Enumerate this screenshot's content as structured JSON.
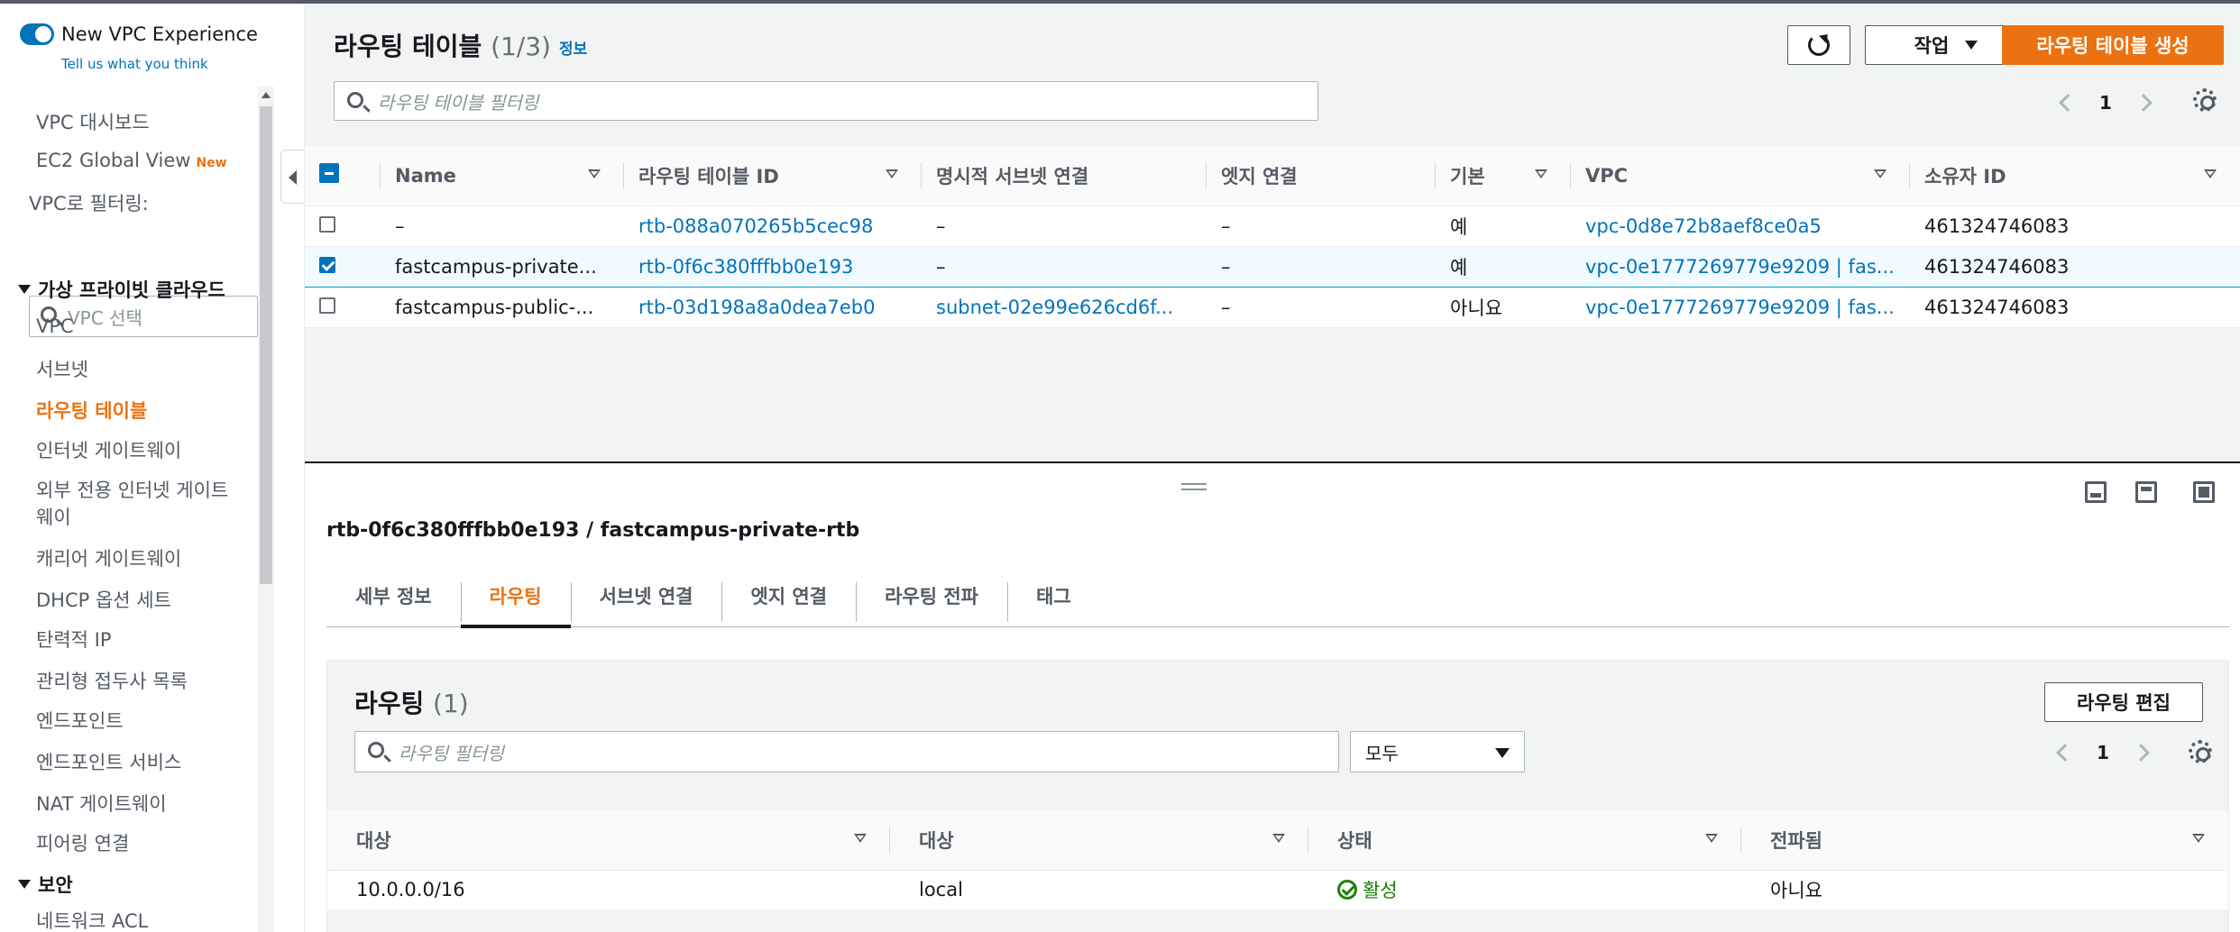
{
  "sidebar": {
    "new_vpc_experience": "New VPC Experience",
    "tell_us": "Tell us what you think",
    "dashboard": "VPC 대시보드",
    "ec2_global_view": "EC2 Global View",
    "new_badge": "New",
    "filter_label": "VPC로 필터링:",
    "vpc_select_placeholder": "VPC 선택",
    "group_vpc": "가상 프라이빗 클라우드",
    "items": [
      "VPC",
      "서브넷",
      "라우팅 테이블",
      "인터넷 게이트웨이",
      "외부 전용 인터넷 게이트",
      "웨이",
      "캐리어 게이트웨이",
      "DHCP 옵션 세트",
      "탄력적 IP",
      "관리형 접두사 목록",
      "엔드포인트",
      "엔드포인트 서비스",
      "NAT 게이트웨이",
      "피어링 연결"
    ],
    "group_security": "보안",
    "security_items": [
      "네트워크 ACL"
    ]
  },
  "header": {
    "title": "라우팅 테이블",
    "count": "(1/3)",
    "info": "정보",
    "actions_label": "작업",
    "create_label": "라우팅 테이블 생성",
    "filter_placeholder": "라우팅 테이블 필터링",
    "page": "1"
  },
  "table": {
    "columns": [
      "Name",
      "라우팅 테이블 ID",
      "명시적 서브넷 연결",
      "엣지 연결",
      "기본",
      "VPC",
      "소유자 ID"
    ],
    "rows": [
      {
        "name": "–",
        "id": "rtb-088a070265b5cec98",
        "subnet": "–",
        "edge": "–",
        "main": "예",
        "vpc": "vpc-0d8e72b8aef8ce0a5",
        "owner": "461324746083",
        "selected": false
      },
      {
        "name": "fastcampus-private...",
        "id": "rtb-0f6c380fffbb0e193",
        "subnet": "–",
        "edge": "–",
        "main": "예",
        "vpc": "vpc-0e1777269779e9209 | fas...",
        "owner": "461324746083",
        "selected": true
      },
      {
        "name": "fastcampus-public-...",
        "id": "rtb-03d198a8a0dea7eb0",
        "subnet": "subnet-02e99e626cd6f...",
        "edge": "–",
        "main": "아니요",
        "vpc": "vpc-0e1777269779e9209 | fas...",
        "owner": "461324746083",
        "selected": false
      }
    ]
  },
  "detail": {
    "title": "rtb-0f6c380fffbb0e193 / fastcampus-private-rtb",
    "tabs": [
      "세부 정보",
      "라우팅",
      "서브넷 연결",
      "엣지 연결",
      "라우팅 전파",
      "태그"
    ],
    "active_tab": 1,
    "routes_title": "라우팅",
    "routes_count": "(1)",
    "edit_routes": "라우팅 편집",
    "routes_filter_placeholder": "라우팅 필터링",
    "select_value": "모두",
    "page": "1",
    "columns": [
      "대상",
      "대상",
      "상태",
      "전파됨"
    ],
    "rows": [
      {
        "destination": "10.0.0.0/16",
        "target": "local",
        "status": "활성",
        "propagated": "아니요"
      }
    ]
  },
  "colors": {
    "accent": "#ec7211",
    "link": "#0073bb",
    "success": "#1d8102"
  }
}
